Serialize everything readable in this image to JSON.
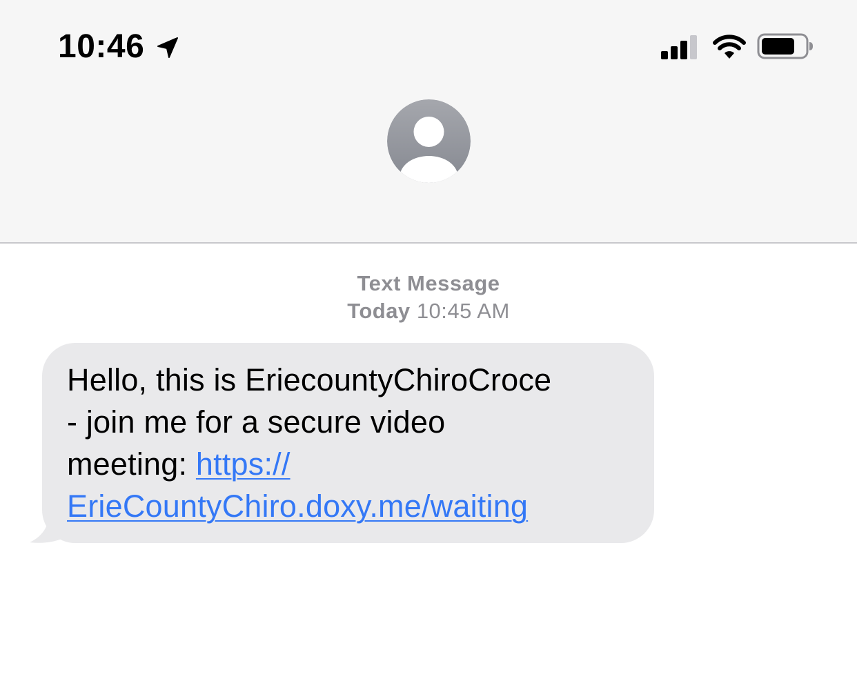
{
  "status_bar": {
    "time": "10:46",
    "icons": [
      "location-arrow-icon",
      "cellular-signal-icon",
      "wifi-icon",
      "battery-icon"
    ]
  },
  "contact": {
    "avatar_icon": "person-silhouette-icon"
  },
  "conversation": {
    "service_label": "Text Message",
    "day": "Today",
    "time": "10:45 AM",
    "messages": [
      {
        "direction": "incoming",
        "lines": [
          "Hello, this is EriecountyChiroCroce",
          "- join me for a secure video",
          "meeting: "
        ],
        "link_part1": "https://",
        "link_part2": "ErieCountyChiro.doxy.me/waiting"
      }
    ]
  },
  "colors": {
    "header_bg": "#f6f6f6",
    "bubble_incoming": "#e9e9eb",
    "link": "#3478f6",
    "meta_text": "#8e8e93",
    "avatar_gradient_top": "#a5a7ad",
    "avatar_gradient_bottom": "#868991"
  }
}
